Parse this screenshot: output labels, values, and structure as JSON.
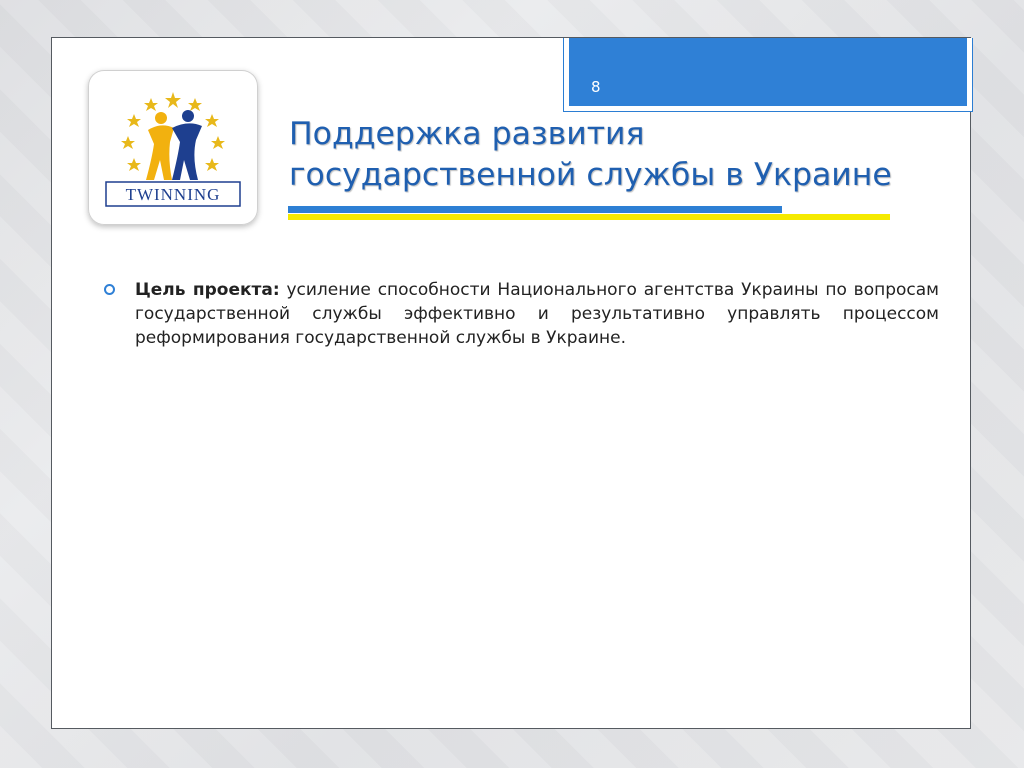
{
  "slide": {
    "page_number": "8",
    "title_line1": "Поддержка развития",
    "title_line2": "государственной службы в Украине"
  },
  "logo": {
    "text": "TWINNING",
    "icon": "twinning-logo-icon"
  },
  "content": {
    "bullet_label": "Цель проекта:",
    "bullet_text": "усиление способности Национального агентства Украины по вопросам государственной службы эффективно и результативно управлять процессом реформирования государственной службы в Украине."
  },
  "colors": {
    "accent_blue": "#2f80d6",
    "title_blue": "#1f5fb0",
    "accent_yellow": "#f5ea00"
  }
}
